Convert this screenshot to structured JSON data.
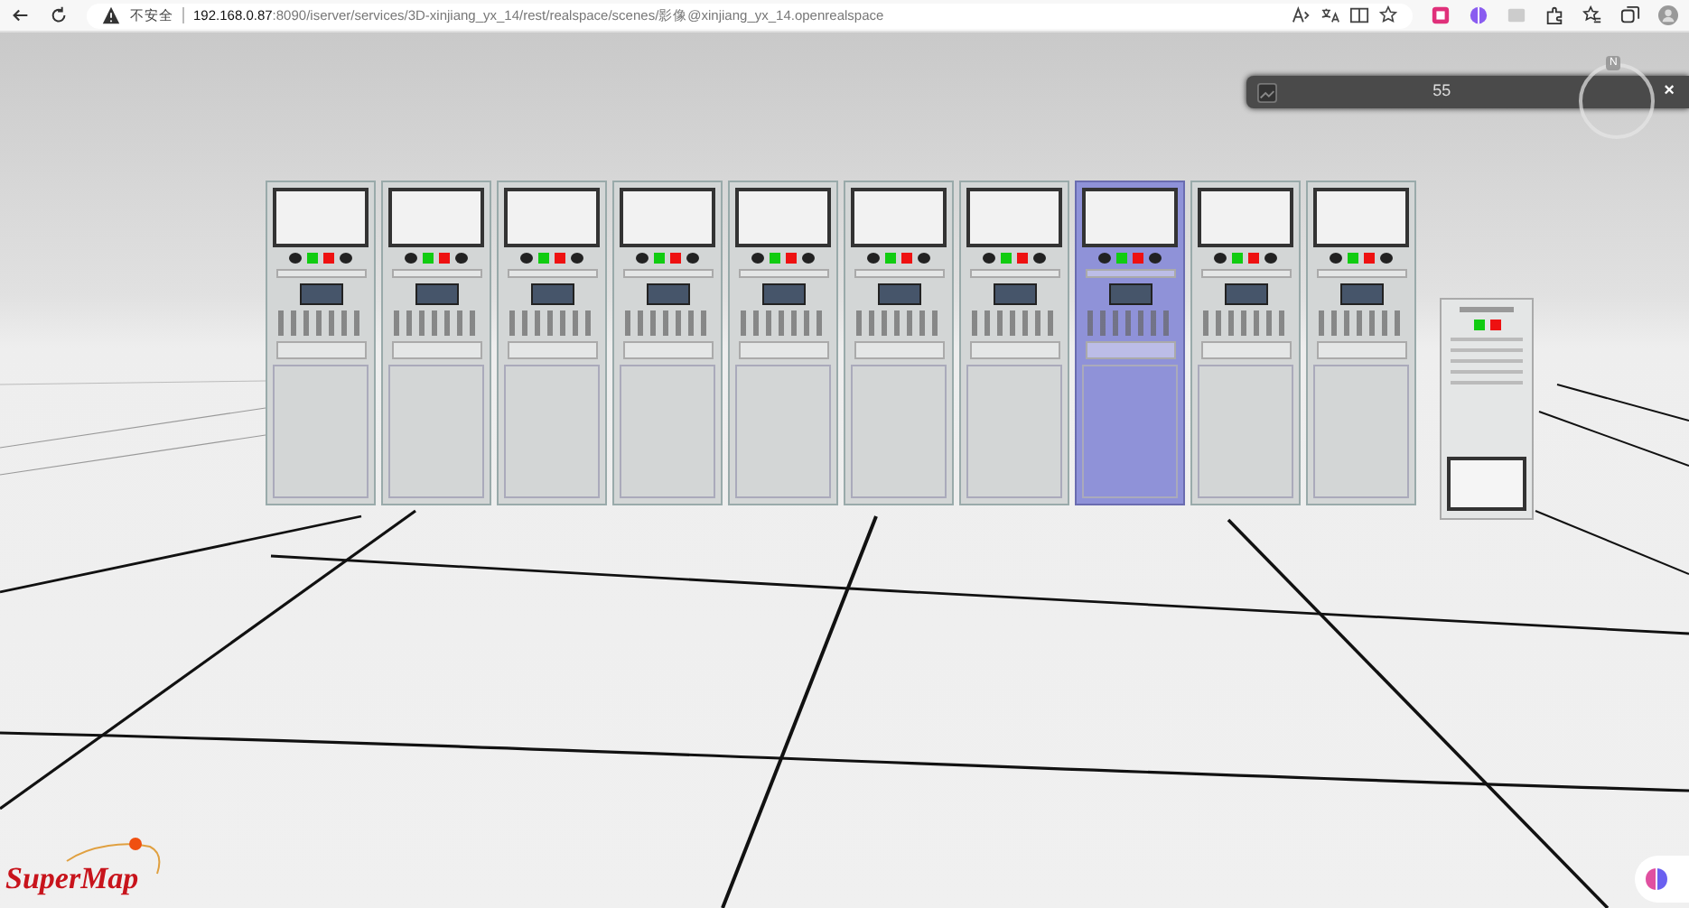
{
  "browser": {
    "security_label": "不安全",
    "url_host": "192.168.0.87",
    "url_path": ":8090/iserver/services/3D-xinjiang_yx_14/rest/realspace/scenes/影像@xinjiang_yx_14.openrealspace"
  },
  "info_panel": {
    "value": "55",
    "close": "×"
  },
  "compass": {
    "label": "N"
  },
  "logo": {
    "text": "SuperMap"
  },
  "cabinets": [
    {
      "selected": false
    },
    {
      "selected": false
    },
    {
      "selected": false
    },
    {
      "selected": false
    },
    {
      "selected": false
    },
    {
      "selected": false
    },
    {
      "selected": false
    },
    {
      "selected": true
    },
    {
      "selected": false
    },
    {
      "selected": false
    }
  ]
}
